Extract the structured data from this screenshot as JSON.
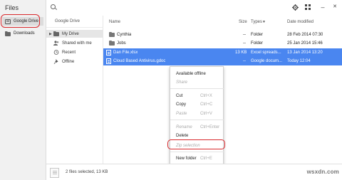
{
  "app": {
    "title": "Files"
  },
  "roots": [
    {
      "label": "Google Drive",
      "icon": "google-drive-icon"
    },
    {
      "label": "Downloads",
      "icon": "downloads-folder-icon"
    }
  ],
  "toolbar": {
    "settings_icon": "gear-icon",
    "view_icon": "grid-view-icon",
    "minimize_label": "–",
    "close_label": "✕"
  },
  "tree": {
    "header": "Google Drive",
    "items": [
      {
        "label": "My Drive",
        "icon": "drive-icon"
      },
      {
        "label": "Shared with me",
        "icon": "people-icon"
      },
      {
        "label": "Recent",
        "icon": "clock-icon"
      },
      {
        "label": "Offline",
        "icon": "pin-icon"
      }
    ]
  },
  "list": {
    "columns": {
      "name": "Name",
      "size": "Size",
      "type": "Types",
      "date": "Date modified"
    },
    "rows": [
      {
        "name": "Cynthia",
        "size": "--",
        "type": "Folder",
        "date": "28 Feb 2014 07:30",
        "selected": false,
        "icon": "folder-icon"
      },
      {
        "name": "Jobs",
        "size": "--",
        "type": "Folder",
        "date": "25 Jan 2014 15:46",
        "selected": false,
        "icon": "folder-icon"
      },
      {
        "name": "Dan File.xlsx",
        "size": "13 KB",
        "type": "Excel spreads...",
        "date": "13 Jan 2014 13:20",
        "selected": true,
        "icon": "spreadsheet-icon"
      },
      {
        "name": "Cloud Based Antivirus.gdoc",
        "size": "--",
        "type": "Google docum...",
        "date": "Today 12:04",
        "selected": true,
        "icon": "document-icon"
      }
    ]
  },
  "menu": {
    "items": [
      {
        "label": "Available offline",
        "shortcut": "",
        "disabled": false
      },
      {
        "label": "Share",
        "shortcut": "",
        "disabled": true
      },
      {
        "label": "Cut",
        "shortcut": "Ctrl+X",
        "disabled": false
      },
      {
        "label": "Copy",
        "shortcut": "Ctrl+C",
        "disabled": false
      },
      {
        "label": "Paste",
        "shortcut": "Ctrl+V",
        "disabled": true
      },
      {
        "label": "Rename",
        "shortcut": "Ctrl+Enter",
        "disabled": true
      },
      {
        "label": "Delete",
        "shortcut": "",
        "disabled": false
      },
      {
        "label": "Zip selection",
        "shortcut": "",
        "disabled": true
      },
      {
        "label": "New folder",
        "shortcut": "Ctrl+E",
        "disabled": false
      }
    ]
  },
  "status": {
    "text": "2 files selected, 13 KB"
  },
  "watermark": "wsxdn.com",
  "colors": {
    "selection": "#4a86f0",
    "highlight": "#d8282c",
    "nav_bg": "#f1f1f1"
  }
}
